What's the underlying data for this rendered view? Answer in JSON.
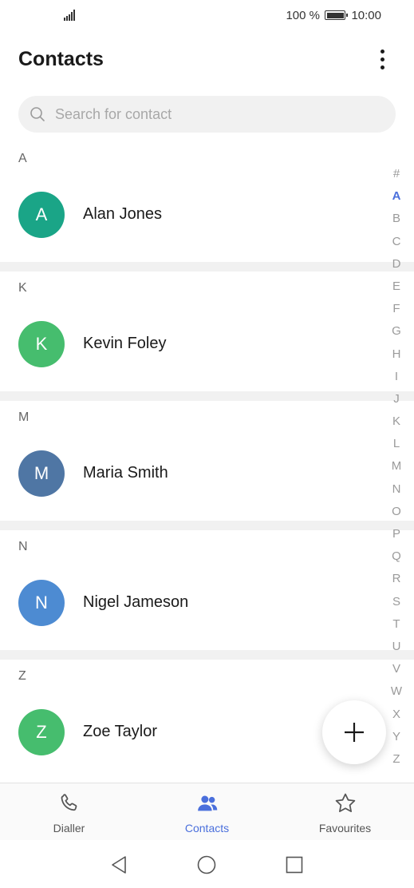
{
  "status_bar": {
    "battery": "100 %",
    "time": "10:00"
  },
  "header": {
    "title": "Contacts",
    "more_icon": "more-vertical-icon"
  },
  "search": {
    "placeholder": "Search for contact",
    "icon": "search-icon"
  },
  "contacts": [
    {
      "letter": "A",
      "initial": "A",
      "name": "Alan Jones",
      "color": "#1aa587"
    },
    {
      "letter": "K",
      "initial": "K",
      "name": "Kevin Foley",
      "color": "#46bd6e"
    },
    {
      "letter": "M",
      "initial": "M",
      "name": "Maria Smith",
      "color": "#4f76a4"
    },
    {
      "letter": "N",
      "initial": "N",
      "name": "Nigel Jameson",
      "color": "#4d8bd2"
    },
    {
      "letter": "Z",
      "initial": "Z",
      "name": "Zoe Taylor",
      "color": "#46bd6e"
    }
  ],
  "alpha_index": [
    "#",
    "A",
    "B",
    "C",
    "D",
    "E",
    "F",
    "G",
    "H",
    "I",
    "J",
    "K",
    "L",
    "M",
    "N",
    "O",
    "P",
    "Q",
    "R",
    "S",
    "T",
    "U",
    "V",
    "W",
    "X",
    "Y",
    "Z"
  ],
  "alpha_index_active": "A",
  "bottom_nav": [
    {
      "label": "Dialler",
      "icon": "phone-icon",
      "active": false
    },
    {
      "label": "Contacts",
      "icon": "contacts-icon",
      "active": true
    },
    {
      "label": "Favourites",
      "icon": "star-icon",
      "active": false
    }
  ],
  "fab": {
    "icon": "add-icon"
  },
  "colors": {
    "accent": "#4a6fdc"
  }
}
